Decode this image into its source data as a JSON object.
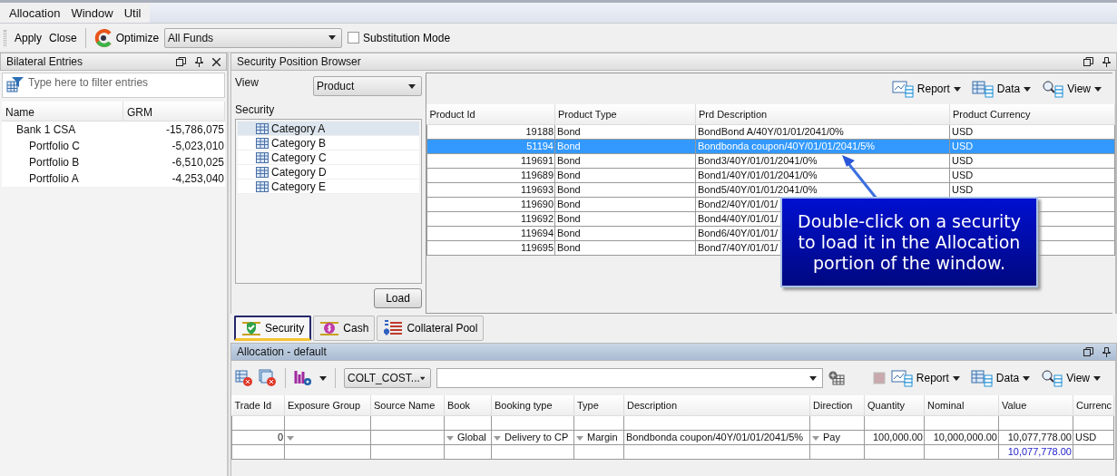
{
  "menu": [
    {
      "label": "Allocation"
    },
    {
      "label": "Window"
    },
    {
      "label": "Util"
    }
  ],
  "toolbar": {
    "buttons": [
      "Apply",
      "Close"
    ],
    "optimize": "Optimize",
    "fund_select": "All Funds",
    "substitution_mode": {
      "label": "Substitution Mode",
      "checked": false
    }
  },
  "bilateral_entries": {
    "title": "Bilateral Entries",
    "filter_placeholder": "Type here to filter entries",
    "columns": [
      "Name",
      "GRM"
    ],
    "tree": [
      {
        "name": "Bank 1 CSA",
        "grm": "-15,786,075",
        "children": [
          {
            "name": "Portfolio C",
            "grm": "-5,023,010"
          },
          {
            "name": "Portfolio B",
            "grm": "-6,510,025"
          },
          {
            "name": "Portfolio A",
            "grm": "-4,253,040"
          }
        ]
      }
    ]
  },
  "security_position_browser": {
    "title": "Security Position Browser",
    "view_label": "View",
    "view_value": "Product",
    "security_label": "Security",
    "categories": [
      {
        "label": "Category A",
        "selected": true
      },
      {
        "label": "Category B",
        "selected": false
      },
      {
        "label": "Category C",
        "selected": false
      },
      {
        "label": "Category D",
        "selected": false
      },
      {
        "label": "Category E",
        "selected": false
      }
    ],
    "load_button": "Load",
    "toolbar": [
      "Report",
      "Data",
      "View"
    ],
    "table": {
      "columns": [
        "Product Id",
        "Product Type",
        "Prd Description",
        "Product Currency"
      ],
      "rows": [
        {
          "cells": [
            "19188",
            "Bond",
            "BondBond A/40Y/01/01/2041/0%",
            "USD"
          ],
          "selected": false
        },
        {
          "cells": [
            "51194",
            "Bond",
            "Bondbonda coupon/40Y/01/01/2041/5%",
            "USD"
          ],
          "selected": true
        },
        {
          "cells": [
            "119691",
            "Bond",
            "Bond3/40Y/01/01/2041/0%",
            "USD"
          ],
          "selected": false
        },
        {
          "cells": [
            "119689",
            "Bond",
            "Bond1/40Y/01/01/2041/0%",
            "USD"
          ],
          "selected": false
        },
        {
          "cells": [
            "119693",
            "Bond",
            "Bond5/40Y/01/01/2041/0%",
            "USD"
          ],
          "selected": false
        },
        {
          "cells": [
            "119690",
            "Bond",
            "Bond2/40Y/01/01/"
          ],
          "selected": false
        },
        {
          "cells": [
            "119692",
            "Bond",
            "Bond4/40Y/01/01/"
          ],
          "selected": false
        },
        {
          "cells": [
            "119694",
            "Bond",
            "Bond6/40Y/01/01/"
          ],
          "selected": false
        },
        {
          "cells": [
            "119695",
            "Bond",
            "Bond7/40Y/01/01/"
          ],
          "selected": false
        }
      ]
    }
  },
  "callout": {
    "text": "Double-click on a security to load it in the Allocation portion of the window."
  },
  "tabs": [
    {
      "label": "Security",
      "selected": true,
      "highlighted": true
    },
    {
      "label": "Cash",
      "selected": false,
      "highlighted": false
    },
    {
      "label": "Collateral Pool",
      "selected": false,
      "highlighted": false
    }
  ],
  "allocation": {
    "title": "Allocation - default",
    "template_select": "COLT_COST...",
    "toolbar": [
      "Report",
      "Data",
      "View"
    ],
    "table": {
      "columns": [
        "Trade Id",
        "Exposure Group",
        "Source Name",
        "Book",
        "Booking type",
        "Type",
        "Description",
        "Direction",
        "Quantity",
        "Nominal",
        "Value",
        "Currenc"
      ],
      "rows": [
        {
          "kind": "blank",
          "cells": []
        },
        {
          "kind": "data",
          "cells": [
            {
              "text": "0"
            },
            {
              "dropdown": true
            },
            {},
            {
              "text": "Global",
              "dropdown": true
            },
            {
              "text": "Delivery to CP",
              "dropdown": true
            },
            {
              "text": "Margin",
              "dropdown": true
            },
            {
              "text": "Bondbonda coupon/40Y/01/01/2041/5%"
            },
            {
              "text": "Pay",
              "dropdown": true
            },
            {
              "text": "100,000.00"
            },
            {
              "text": "10,000,000.00"
            },
            {
              "text": "10,077,778.00"
            },
            {
              "text": "USD"
            }
          ]
        },
        {
          "kind": "total",
          "cells": [
            {},
            {},
            {},
            {},
            {},
            {},
            {},
            {},
            {},
            {},
            {
              "text": "10,077,778.00"
            }
          ]
        }
      ]
    }
  }
}
